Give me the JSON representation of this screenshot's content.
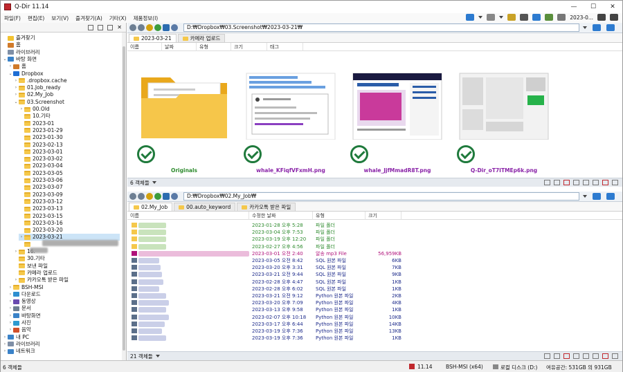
{
  "window": {
    "title": "Q-Dir 11.14"
  },
  "menu": {
    "items": [
      "파일(F)",
      "편집(E)",
      "보기(V)",
      "즐겨찾기(A)",
      "기타(X)",
      "제품정보(I)"
    ],
    "date_label": "2023-0..."
  },
  "tree": [
    {
      "label": "즐겨찾기",
      "icon": "star-icon",
      "exp": ""
    },
    {
      "label": "홈",
      "icon": "home-icon",
      "exp": ""
    },
    {
      "label": "라이브러리",
      "icon": "library-icon",
      "exp": ""
    },
    {
      "label": "바탕 화면",
      "icon": "desktop-icon",
      "exp": "⌄"
    },
    {
      "label": "홈",
      "icon": "home-icon",
      "exp": "›"
    },
    {
      "label": "Dropbox",
      "icon": "dropbox-icon",
      "exp": "⌄"
    },
    {
      "label": ".dropbox.cache",
      "icon": "folder-icon",
      "exp": "›"
    },
    {
      "label": "01.Job_ready",
      "icon": "folder-icon",
      "exp": "›"
    },
    {
      "label": "02.My_Job",
      "icon": "folder-icon",
      "exp": "›"
    },
    {
      "label": "03.Screenshot",
      "icon": "folder-icon",
      "exp": "⌄"
    },
    {
      "label": "00.Old",
      "icon": "folder-icon",
      "exp": "›"
    },
    {
      "label": "10.기타",
      "icon": "folder-icon",
      "exp": ""
    },
    {
      "label": "2023-01",
      "icon": "folder-icon",
      "exp": ""
    },
    {
      "label": "2023-01-29",
      "icon": "folder-icon",
      "exp": ""
    },
    {
      "label": "2023-01-30",
      "icon": "folder-icon",
      "exp": ""
    },
    {
      "label": "2023-02-13",
      "icon": "folder-icon",
      "exp": ""
    },
    {
      "label": "2023-03-01",
      "icon": "folder-icon",
      "exp": ""
    },
    {
      "label": "2023-03-02",
      "icon": "folder-icon",
      "exp": ""
    },
    {
      "label": "2023-03-04",
      "icon": "folder-icon",
      "exp": ""
    },
    {
      "label": "2023-03-05",
      "icon": "folder-icon",
      "exp": ""
    },
    {
      "label": "2023-03-06",
      "icon": "folder-icon",
      "exp": ""
    },
    {
      "label": "2023-03-07",
      "icon": "folder-icon",
      "exp": ""
    },
    {
      "label": "2023-03-09",
      "icon": "folder-icon",
      "exp": ""
    },
    {
      "label": "2023-03-12",
      "icon": "folder-icon",
      "exp": ""
    },
    {
      "label": "2023-03-13",
      "icon": "folder-icon",
      "exp": ""
    },
    {
      "label": "2023-03-15",
      "icon": "folder-icon",
      "exp": ""
    },
    {
      "label": "2023-03-16",
      "icon": "folder-icon",
      "exp": ""
    },
    {
      "label": "2023-03-20",
      "icon": "folder-icon",
      "exp": ""
    },
    {
      "label": "2023-03-21",
      "icon": "folder-icon",
      "exp": "›"
    },
    {
      "label": "",
      "icon": "folder-icon",
      "exp": ""
    },
    {
      "label": "16.",
      "icon": "folder-icon",
      "exp": "›"
    },
    {
      "label": "30.기타",
      "icon": "folder-icon",
      "exp": ""
    },
    {
      "label": "보낸 파일",
      "icon": "folder-icon",
      "exp": ""
    },
    {
      "label": "카메라 업로드",
      "icon": "folder-icon",
      "exp": ""
    },
    {
      "label": "카카오톡 받은 파일",
      "icon": "folder-icon",
      "exp": "›"
    },
    {
      "label": "BSH-MSI",
      "icon": "folder-icon",
      "exp": "›"
    },
    {
      "label": "다운로드",
      "icon": "download-icon",
      "exp": "›"
    },
    {
      "label": "동영상",
      "icon": "video-icon",
      "exp": "›"
    },
    {
      "label": "문서",
      "icon": "document-icon",
      "exp": "›"
    },
    {
      "label": "바탕화면",
      "icon": "desktop-icon",
      "exp": "›"
    },
    {
      "label": "사진",
      "icon": "picture-icon",
      "exp": "›"
    },
    {
      "label": "음악",
      "icon": "music-icon",
      "exp": "›"
    },
    {
      "label": "내 PC",
      "icon": "pc-icon",
      "exp": "›"
    },
    {
      "label": "라이브러리",
      "icon": "library-icon",
      "exp": "›"
    },
    {
      "label": "네트워크",
      "icon": "network-icon",
      "exp": "›"
    }
  ],
  "top_pane": {
    "path": "D:₩Dropbox₩03.Screenshot₩2023-03-21₩",
    "tabs": [
      "2023-03-21",
      "카메라 업로드"
    ],
    "columns": [
      "이름",
      "날짜",
      "유형",
      "크기",
      "태그"
    ],
    "items": [
      {
        "caption": "Originals",
        "kind": "folder"
      },
      {
        "caption": "whale_KFiqfVFxmH.png",
        "kind": "dialog"
      },
      {
        "caption": "whale_JjfMmadR8T.png",
        "kind": "web"
      },
      {
        "caption": "Q-Dir_oT7ITMEp6k.png",
        "kind": "blur"
      }
    ],
    "status": "6 객체들"
  },
  "bottom_pane": {
    "path": "D:₩Dropbox₩02.My_Job₩",
    "tabs": [
      "02.My_Job",
      "00.auto_keyword",
      "카카오톡 받은 파일"
    ],
    "columns": [
      "이름",
      "수정한 날짜",
      "유형",
      "크기"
    ],
    "rows": [
      {
        "date": "2023-01-28 오후 5:28",
        "type": "파일 폴더",
        "size": "",
        "color": "#2e8b2e",
        "icon": "folder-icon"
      },
      {
        "date": "2023-03-04 오후 7:53",
        "type": "파일 폴더",
        "size": "",
        "color": "#2e8b2e",
        "icon": "folder-icon"
      },
      {
        "date": "2023-03-19 오후 12:20",
        "type": "파일 폴더",
        "size": "",
        "color": "#2e8b2e",
        "icon": "folder-icon"
      },
      {
        "date": "2023-02-27 오후 4:56",
        "type": "파일 폴더",
        "size": "",
        "color": "#2e8b2e",
        "icon": "folder-icon"
      },
      {
        "date": "2023-03-01 오전 2:40",
        "type": "알송 mp3 File",
        "size": "56,959KB",
        "color": "#b0117a",
        "icon": "music-file-icon"
      },
      {
        "date": "2023-03-05 오전 8:42",
        "type": "SQL 원본 파일",
        "size": "6KB",
        "color": "#1c2a8a",
        "icon": "file-icon"
      },
      {
        "date": "2023-03-20 오후 3:31",
        "type": "SQL 원본 파일",
        "size": "7KB",
        "color": "#1c2a8a",
        "icon": "file-icon"
      },
      {
        "date": "2023-03-21 오전 9:44",
        "type": "SQL 원본 파일",
        "size": "9KB",
        "color": "#1c2a8a",
        "icon": "file-icon"
      },
      {
        "date": "2023-02-28 오후 4:47",
        "type": "SQL 원본 파일",
        "size": "1KB",
        "color": "#1c2a8a",
        "icon": "file-icon"
      },
      {
        "date": "2023-02-28 오후 6:02",
        "type": "SQL 원본 파일",
        "size": "1KB",
        "color": "#1c2a8a",
        "icon": "file-icon"
      },
      {
        "date": "2023-03-21 오전 9:12",
        "type": "Python 원본 파일",
        "size": "2KB",
        "color": "#1c2a8a",
        "icon": "file-icon"
      },
      {
        "date": "2023-03-20 오후 7:09",
        "type": "Python 원본 파일",
        "size": "4KB",
        "color": "#1c2a8a",
        "icon": "file-icon"
      },
      {
        "date": "2023-03-13 오후 9:58",
        "type": "Python 원본 파일",
        "size": "1KB",
        "color": "#1c2a8a",
        "icon": "file-icon"
      },
      {
        "date": "2023-02-07 오후 10:18",
        "type": "Python 원본 파일",
        "size": "10KB",
        "color": "#1c2a8a",
        "icon": "file-icon"
      },
      {
        "date": "2023-03-17 오후 6:44",
        "type": "Python 원본 파일",
        "size": "14KB",
        "color": "#1c2a8a",
        "icon": "file-icon"
      },
      {
        "date": "2023-03-19 오후 7:36",
        "type": "Python 원본 파일",
        "size": "13KB",
        "color": "#1c2a8a",
        "icon": "file-icon"
      },
      {
        "date": "2023-03-19 오후 7:36",
        "type": "Python 원본 파일",
        "size": "1KB",
        "color": "#1c2a8a",
        "icon": "file-icon"
      }
    ],
    "status": "21 객체들"
  },
  "statusbar": {
    "left": "6 객체들",
    "version": "11.14",
    "machine": "BSH-MSI (x64)",
    "drive": "로컬 디스크 (D:)",
    "space": "여유공간: 531GB 의 931GB"
  }
}
